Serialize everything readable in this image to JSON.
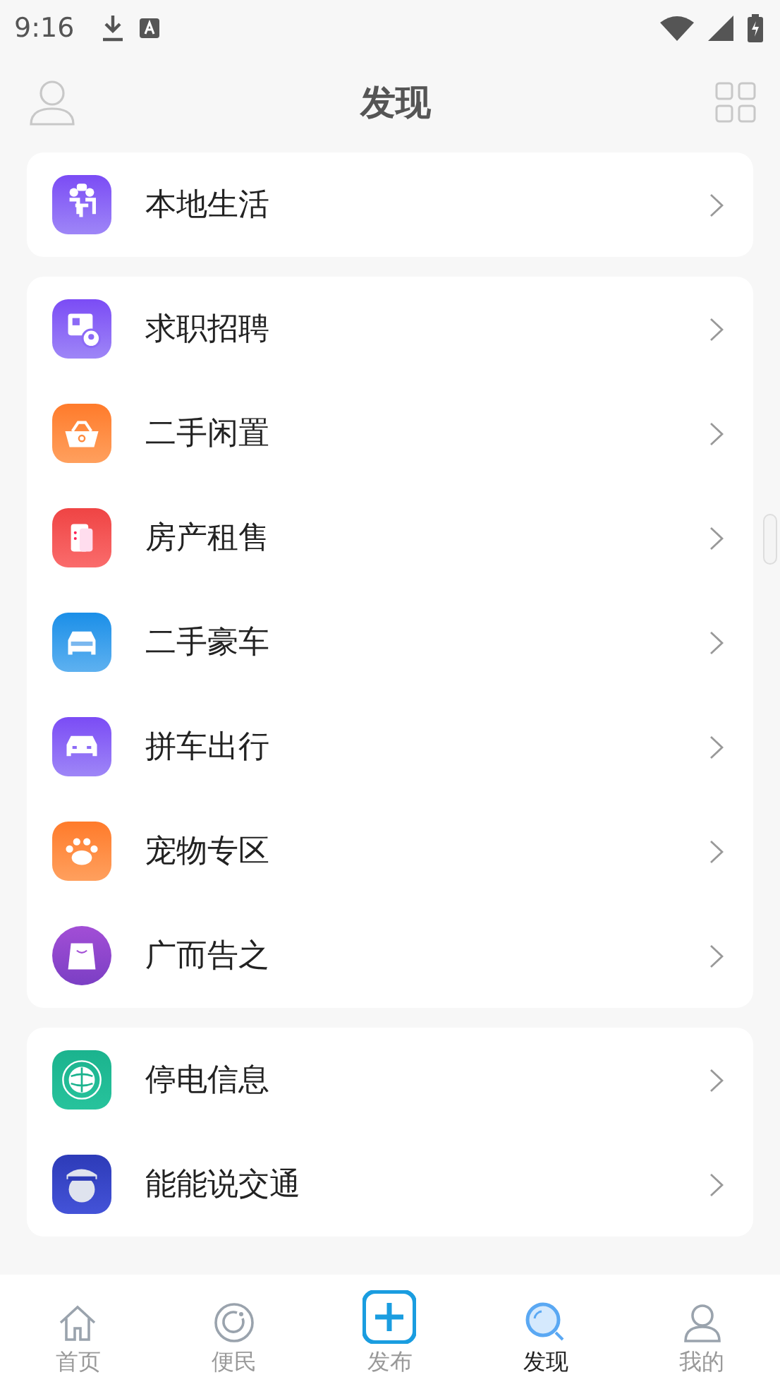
{
  "status_bar": {
    "time": "9:16"
  },
  "header": {
    "title": "发现"
  },
  "sections": [
    {
      "items": [
        {
          "kind": "group",
          "label": "本地生活"
        }
      ]
    },
    {
      "items": [
        {
          "kind": "job",
          "label": "求职招聘"
        },
        {
          "kind": "market",
          "label": "二手闲置"
        },
        {
          "kind": "house",
          "label": "房产租售"
        },
        {
          "kind": "car",
          "label": "二手豪车"
        },
        {
          "kind": "carpool",
          "label": "拼车出行"
        },
        {
          "kind": "pet",
          "label": "宠物专区"
        },
        {
          "kind": "ad",
          "label": "广而告之"
        }
      ]
    },
    {
      "items": [
        {
          "kind": "power",
          "label": "停电信息"
        },
        {
          "kind": "traffic",
          "label": "能能说交通"
        }
      ]
    }
  ],
  "tab_bar": [
    {
      "kind": "home",
      "label": "首页",
      "selected": false
    },
    {
      "kind": "service",
      "label": "便民",
      "selected": false
    },
    {
      "kind": "publish",
      "label": "发布",
      "selected": false
    },
    {
      "kind": "discover",
      "label": "发现",
      "selected": true
    },
    {
      "kind": "me",
      "label": "我的",
      "selected": false
    }
  ]
}
